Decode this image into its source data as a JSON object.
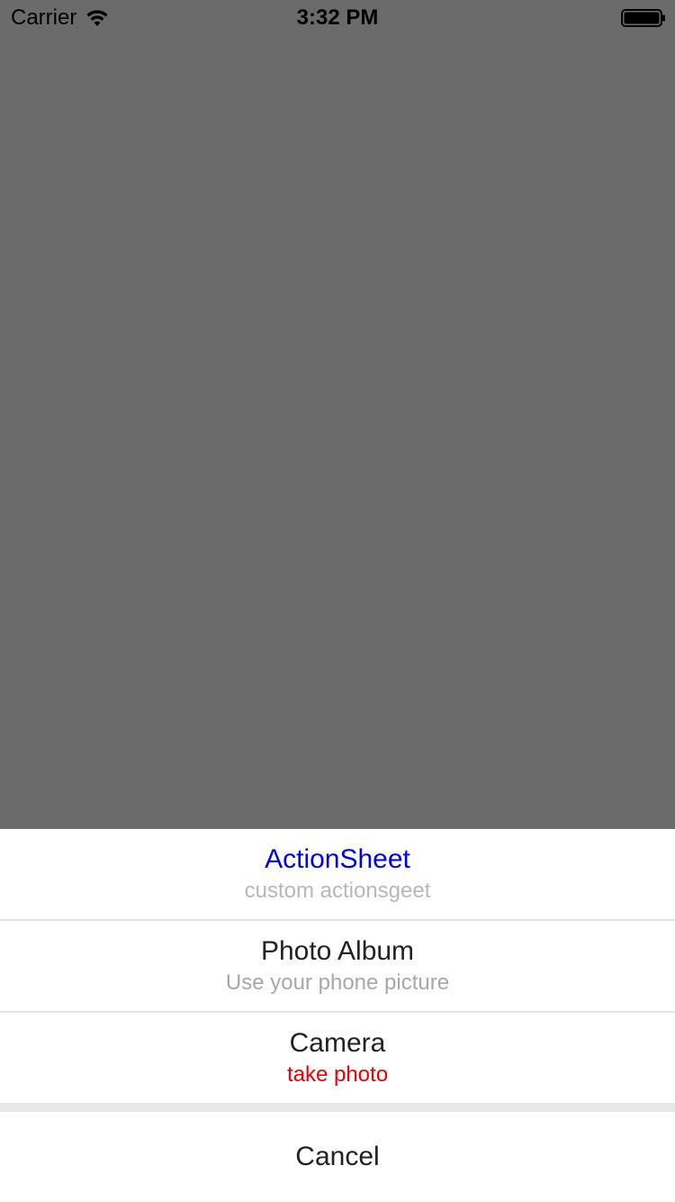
{
  "status_bar": {
    "carrier": "Carrier",
    "time": "3:32 PM",
    "icons": [
      "wifi-icon",
      "battery-icon"
    ]
  },
  "colors": {
    "dim_overlay": "#6b6b6b",
    "sheet_background": "#ffffff",
    "divider": "#e4e4e4",
    "gap": "#e8e8e8",
    "title_accent": "#0000ee",
    "subtitle_gray": "#b3b3b3",
    "item_text": "#222222",
    "danger_red": "#e8000b"
  },
  "action_sheet": {
    "header": {
      "title": "ActionSheet",
      "subtitle": "custom actionsgeet"
    },
    "items": [
      {
        "title": "Photo Album",
        "subtitle": "Use your phone picture"
      },
      {
        "title": "Camera",
        "subtitle": "take photo"
      }
    ],
    "cancel_label": "Cancel"
  }
}
